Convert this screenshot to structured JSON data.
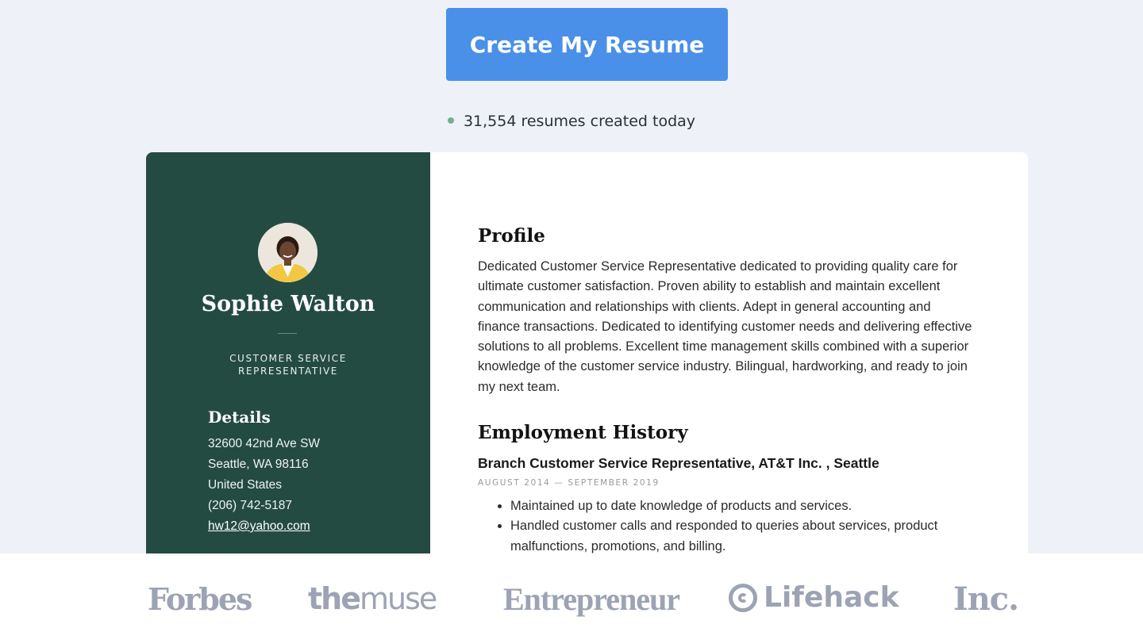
{
  "cta": {
    "label": "Create My Resume"
  },
  "counter": {
    "text": "31,554 resumes created today",
    "dot_color": "#6fb38a"
  },
  "resume": {
    "sidebar_color": "#244b42",
    "name": "Sophie Walton",
    "role_line1": "CUSTOMER SERVICE",
    "role_line2": "REPRESENTATIVE",
    "details_title": "Details",
    "details": {
      "address1": "32600 42nd Ave SW",
      "address2": "Seattle, WA 98116",
      "country": "United States",
      "phone": "(206) 742-5187",
      "email": "hw12@yahoo.com"
    },
    "profile_title": "Profile",
    "profile_text": "Dedicated Customer Service Representative dedicated to providing quality care for ultimate customer satisfaction. Proven ability to establish and maintain excellent communication and relationships with clients. Adept in general accounting and finance transactions. Dedicated to identifying customer needs and delivering effective solutions to all problems. Excellent time management skills combined with a superior knowledge of the customer service industry. Bilingual, hardworking, and ready to join my next team.",
    "employment_title": "Employment History",
    "job_title": "Branch Customer Service Representative, AT&T Inc. , Seattle",
    "job_dates": "AUGUST 2014 — SEPTEMBER 2019",
    "bullets": [
      "Maintained up to date knowledge of products and services.",
      "Handled customer calls and responded to queries about services, product malfunctions, promotions, and billing."
    ]
  },
  "logos": {
    "forbes": "Forbes",
    "muse_a": "the",
    "muse_b": "muse",
    "entrepreneur": "Entrepreneur",
    "lifehack": "Lifehack",
    "inc": "Inc."
  },
  "colors": {
    "accent": "#4a90e8",
    "logo_gray": "#9ca3b4",
    "page_bg": "#eef2f8"
  }
}
